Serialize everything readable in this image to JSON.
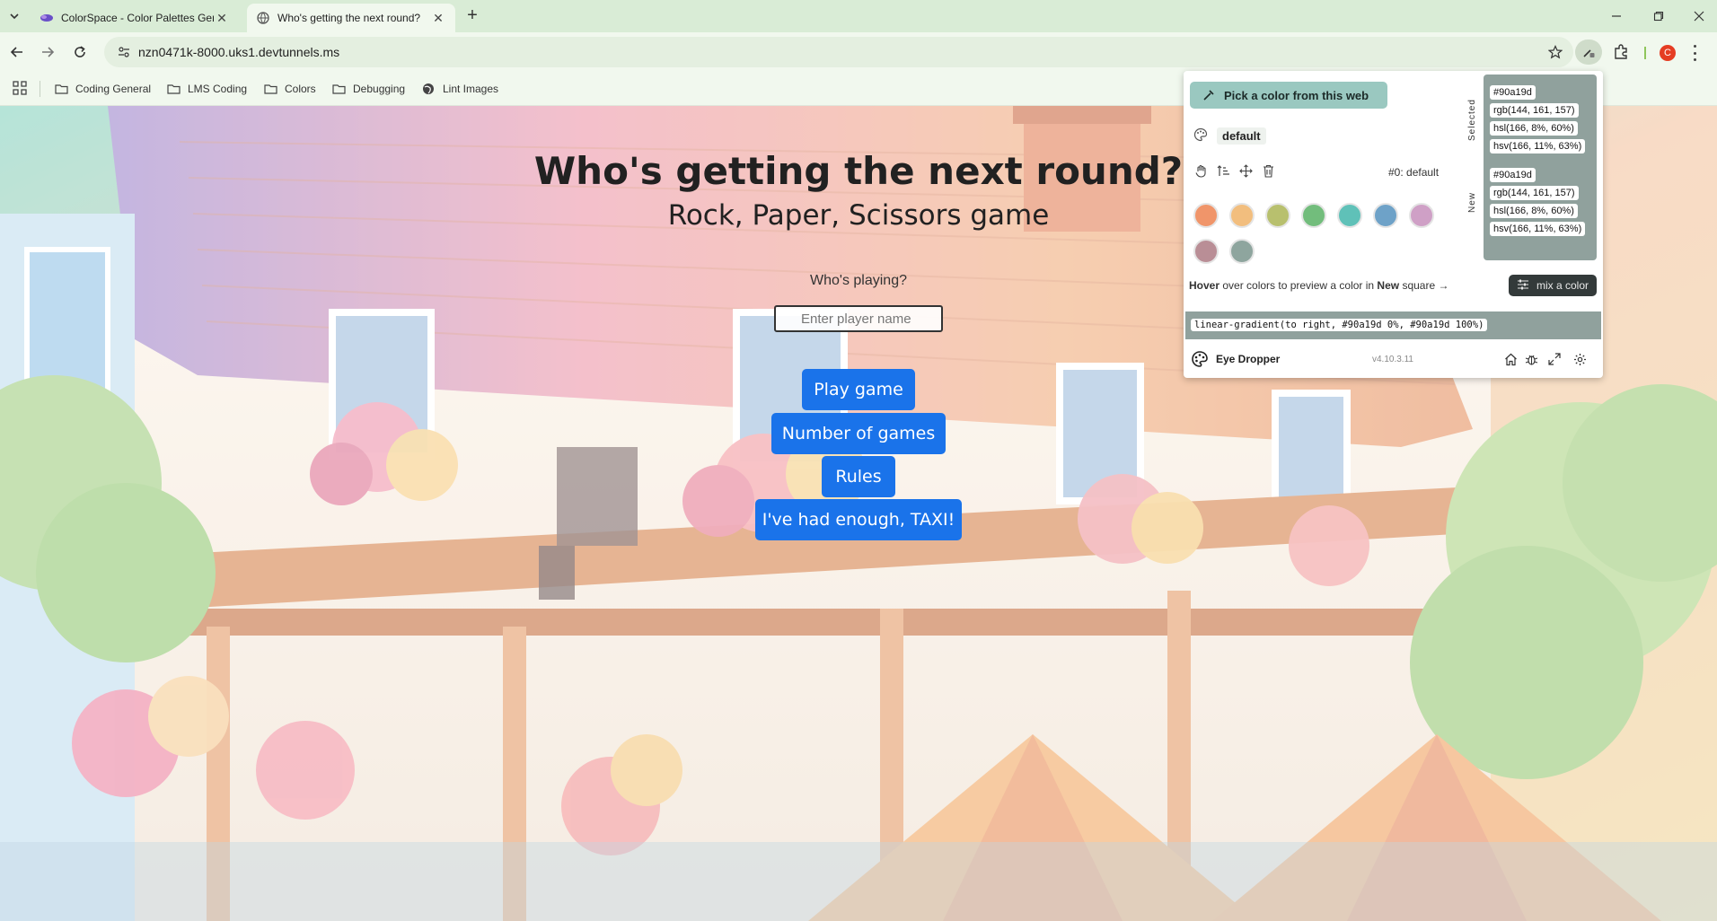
{
  "browser": {
    "tabs": [
      {
        "title": "ColorSpace - Color Palettes Generator",
        "active": false
      },
      {
        "title": "Who's getting the next round?",
        "active": true
      }
    ],
    "url": "nzn0471k-8000.uks1.devtunnels.ms",
    "profile_initial": "C",
    "bookmarks": [
      {
        "label": "Coding General",
        "icon": "folder-icon"
      },
      {
        "label": "LMS Coding",
        "icon": "folder-icon"
      },
      {
        "label": "Colors",
        "icon": "folder-icon"
      },
      {
        "label": "Debugging",
        "icon": "folder-icon"
      },
      {
        "label": "Lint Images",
        "icon": "globe-icon"
      }
    ]
  },
  "page": {
    "title": "Who's getting the next round?",
    "subtitle": "Rock, Paper, Scissors game",
    "prompt": "Who's playing?",
    "player_placeholder": "Enter player name",
    "buttons": {
      "play": "Play game",
      "number": "Number of games",
      "rules": "Rules",
      "quit": "I've had enough, TAXI!"
    },
    "button_color": "#1a73ea"
  },
  "eyedropper": {
    "pick_label": "Pick a color from this web",
    "palette_name": "default",
    "palette_label": "#0: default",
    "swatches": [
      "#f0956a",
      "#f2be7e",
      "#b8c06e",
      "#72bd7c",
      "#5fc1b8",
      "#6ea2c8",
      "#cfa0c6",
      "#b98e96",
      "#8ea59e"
    ],
    "selected_side_label": "Selected",
    "new_side_label": "New",
    "selected": {
      "hex": "#90a19d",
      "rgb": "rgb(144, 161, 157)",
      "hsl": "hsl(166, 8%, 60%)",
      "hsv": "hsv(166, 11%, 63%)"
    },
    "new": {
      "hex": "#90a19d",
      "rgb": "rgb(144, 161, 157)",
      "hsl": "hsl(166, 8%, 60%)",
      "hsv": "hsv(166, 11%, 63%)"
    },
    "hint_bold": "Hover",
    "hint_mid": " over colors to preview a color in ",
    "hint_new": "New",
    "hint_end": " square →",
    "mix_label": "mix a color",
    "gradient": "linear-gradient(to right, #90a19d 0%, #90a19d 100%)",
    "app_name": "Eye Dropper",
    "version": "v4.10.3.11"
  }
}
